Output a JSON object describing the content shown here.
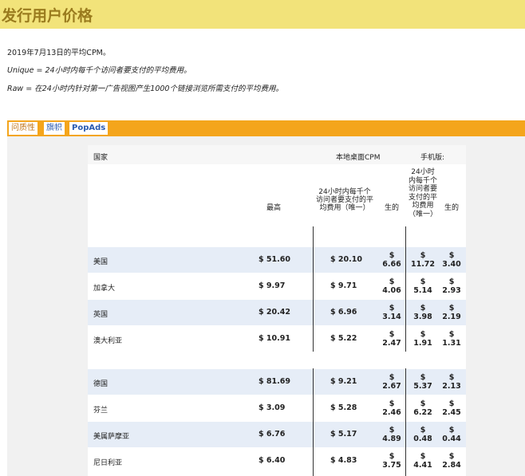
{
  "header": {
    "title": "发行用户价格"
  },
  "info": {
    "line1": "2019年7月13日的平均CPM。",
    "line2": "Unique = 24小时内每千个访问者要支付的平均费用。",
    "line3": "Raw = 在24小时内针对第一广告视图产生1000个链接浏览所需支付的平均费用。"
  },
  "tabs": [
    "问质性",
    "旗帜",
    "PopAds"
  ],
  "table": {
    "col_country": "国家",
    "group_desktop": "本地桌面CPM",
    "group_mobile": "手机版:",
    "sub_highest": "最高",
    "sub_unique_desktop": "24小时内每千个访问者要支付的平均费用（唯一）",
    "sub_raw_desktop": "生的",
    "sub_unique_mobile": "24小时内每千个访问者要支付的平均费用（唯一）",
    "sub_raw_mobile": "生的",
    "rows": [
      {
        "country": "美国",
        "highest": "$ 51.60",
        "unique": "$ 20.10",
        "raw": "$ 6.66",
        "m_unique": "$ 11.72",
        "m_raw": "$ 3.40"
      },
      {
        "country": "加拿大",
        "highest": "$ 9.97",
        "unique": "$ 9.71",
        "raw": "$ 4.06",
        "m_unique": "$ 5.14",
        "m_raw": "$ 2.93"
      },
      {
        "country": "英国",
        "highest": "$ 20.42",
        "unique": "$ 6.96",
        "raw": "$ 3.14",
        "m_unique": "$ 3.98",
        "m_raw": "$ 2.19"
      },
      {
        "country": "澳大利亚",
        "highest": "$ 10.91",
        "unique": "$ 5.22",
        "raw": "$ 2.47",
        "m_unique": "$ 1.91",
        "m_raw": "$ 1.31"
      },
      {
        "country": "德国",
        "highest": "$ 81.69",
        "unique": "$ 9.21",
        "raw": "$ 2.67",
        "m_unique": "$ 5.37",
        "m_raw": "$ 2.13"
      },
      {
        "country": "芬兰",
        "highest": "$ 3.09",
        "unique": "$ 5.28",
        "raw": "$ 2.46",
        "m_unique": "$ 6.22",
        "m_raw": "$ 2.45"
      },
      {
        "country": "美属萨摩亚",
        "highest": "$ 6.76",
        "unique": "$ 5.17",
        "raw": "$ 4.89",
        "m_unique": "$ 0.48",
        "m_raw": "$ 0.44"
      },
      {
        "country": "尼日利亚",
        "highest": "$ 6.40",
        "unique": "$ 4.83",
        "raw": "$ 3.75",
        "m_unique": "$ 4.41",
        "m_raw": "$ 2.84"
      }
    ]
  }
}
